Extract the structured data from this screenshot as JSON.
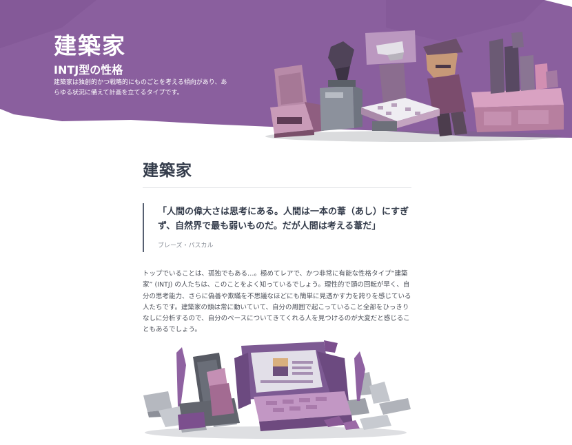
{
  "hero": {
    "title": "建築家",
    "subtitle": "INTJ型の性格",
    "description": "建築家は独創的かつ戦略的にものごとを考える傾向があり、あらゆる状況に備えて計画を立てるタイプです。",
    "illustration_icon": "architect-workshop-illustration"
  },
  "article": {
    "title": "建築家",
    "quote": {
      "text": "「人間の偉大さは思考にある。人間は一本の葦（あし）にすぎず、自然界で最も弱いものだ。だが人間は考える葦だ」",
      "author": "ブレーズ・パスカル"
    },
    "body": "トップでいることは、孤独でもある…。極めてレアで、かつ非常に有能な性格タイプ“建築家” (INTJ) の人たちは、このことをよく知っているでしょう。理性的で頭の回転が早く、自分の思考能力、さらに偽善や欺瞞を不思議なほどにも簡単に見透かす力を誇りを感じている人たちです。建築家の頭は常に動いていて、自分の周囲で起こっていること全部をひっきりなしに分析するので、自分のペースについてきてくれる人を見つけるのが大変だと感じることもあるでしょう。",
    "bottom_illustration_icon": "architect-throne-illustration"
  },
  "colors": {
    "hero_purple": "#8a5f9e",
    "hero_purple_dark": "#6e4a82",
    "heading": "#343c4b",
    "text": "#4a4e57",
    "quote_bar": "#576071",
    "muted": "#8a8f98"
  }
}
